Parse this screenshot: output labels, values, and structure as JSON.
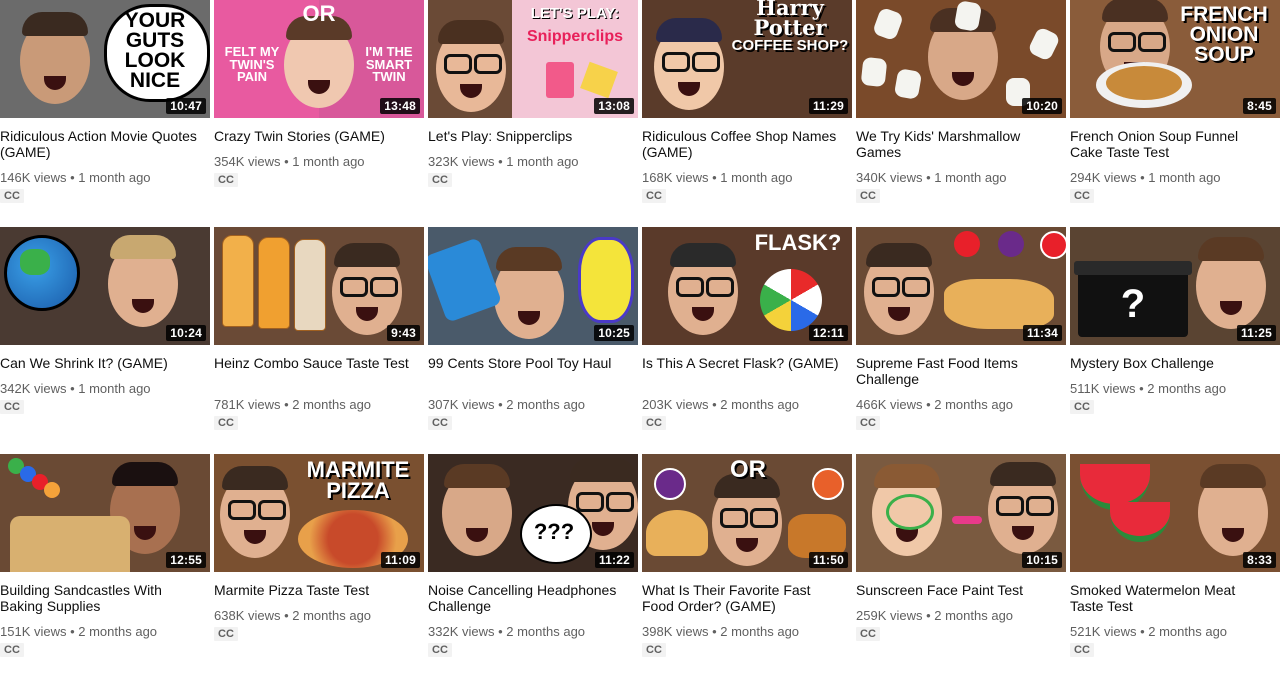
{
  "videos": [
    {
      "title": "Ridiculous Action Movie Quotes (GAME)",
      "views": "146K views",
      "age": "1 month ago",
      "duration": "10:47",
      "cc": "CC",
      "thumb_text": "YOUR GUTS LOOK NICE",
      "thumb_bg": "#6b6b6b"
    },
    {
      "title": "Crazy Twin Stories (GAME)",
      "views": "354K views",
      "age": "1 month ago",
      "duration": "13:48",
      "cc": "CC",
      "thumb_text": "OR",
      "thumb_text2": "FELT MY TWIN'S PAIN",
      "thumb_text3": "I'M THE SMART TWIN",
      "thumb_bg": "#e86aa6"
    },
    {
      "title": "Let's Play: Snipperclips",
      "views": "323K views",
      "age": "1 month ago",
      "duration": "13:08",
      "cc": "CC",
      "thumb_text": "LET'S PLAY:",
      "thumb_text2": "Snipperclips",
      "thumb_bg": "#f3c6d6"
    },
    {
      "title": "Ridiculous Coffee Shop Names (GAME)",
      "views": "168K views",
      "age": "1 month ago",
      "duration": "11:29",
      "cc": "CC",
      "thumb_text": "Harry Potter",
      "thumb_text2": "COFFEE SHOP?",
      "thumb_bg": "#5a3b2a"
    },
    {
      "title": "We Try Kids' Marshmallow Games",
      "views": "340K views",
      "age": "1 month ago",
      "duration": "10:20",
      "cc": "CC",
      "thumb_bg": "#7a4a2a"
    },
    {
      "title": "French Onion Soup Funnel Cake Taste Test",
      "views": "294K views",
      "age": "1 month ago",
      "duration": "8:45",
      "cc": "CC",
      "thumb_text": "FRENCH ONION SOUP",
      "thumb_bg": "#8a5c3a"
    },
    {
      "title": "Can We Shrink It? (GAME)",
      "views": "342K views",
      "age": "1 month ago",
      "duration": "10:24",
      "cc": "CC",
      "thumb_bg": "#4a3a32"
    },
    {
      "title": "Heinz Combo Sauce Taste Test",
      "views": "781K views",
      "age": "2 months ago",
      "duration": "9:43",
      "cc": "CC",
      "thumb_bg": "#6a4a36"
    },
    {
      "title": "99 Cents Store Pool Toy Haul",
      "views": "307K views",
      "age": "2 months ago",
      "duration": "10:25",
      "cc": "CC",
      "thumb_bg": "#4a5a6a"
    },
    {
      "title": "Is This A Secret Flask? (GAME)",
      "views": "203K views",
      "age": "2 months ago",
      "duration": "12:11",
      "cc": "CC",
      "thumb_text": "FLASK?",
      "thumb_bg": "#5a3a2a"
    },
    {
      "title": "Supreme Fast Food Items Challenge",
      "views": "466K views",
      "age": "2 months ago",
      "duration": "11:34",
      "cc": "CC",
      "thumb_bg": "#6a4a34"
    },
    {
      "title": "Mystery Box Challenge",
      "views": "511K views",
      "age": "2 months ago",
      "duration": "11:25",
      "cc": "CC",
      "thumb_text": "?",
      "thumb_bg": "#5a4432"
    },
    {
      "title": "Building Sandcastles With Baking Supplies",
      "views": "151K views",
      "age": "2 months ago",
      "duration": "12:55",
      "cc": "CC",
      "thumb_bg": "#6a4a34"
    },
    {
      "title": "Marmite Pizza Taste Test",
      "views": "638K views",
      "age": "2 months ago",
      "duration": "11:09",
      "cc": "CC",
      "thumb_text": "MARMITE PIZZA",
      "thumb_bg": "#7a5030"
    },
    {
      "title": "Noise Cancelling Headphones Challenge",
      "views": "332K views",
      "age": "2 months ago",
      "duration": "11:22",
      "cc": "CC",
      "thumb_text": "???",
      "thumb_bg": "#3a2a22"
    },
    {
      "title": "What Is Their Favorite Fast Food Order? (GAME)",
      "views": "398K views",
      "age": "2 months ago",
      "duration": "11:50",
      "cc": "CC",
      "thumb_text": "OR",
      "thumb_bg": "#6a4a34"
    },
    {
      "title": "Sunscreen Face Paint Test",
      "views": "259K views",
      "age": "2 months ago",
      "duration": "10:15",
      "cc": "CC",
      "thumb_bg": "#7a5a40"
    },
    {
      "title": "Smoked Watermelon Meat Taste Test",
      "views": "521K views",
      "age": "2 months ago",
      "duration": "8:33",
      "cc": "CC",
      "thumb_bg": "#7a5032"
    }
  ]
}
